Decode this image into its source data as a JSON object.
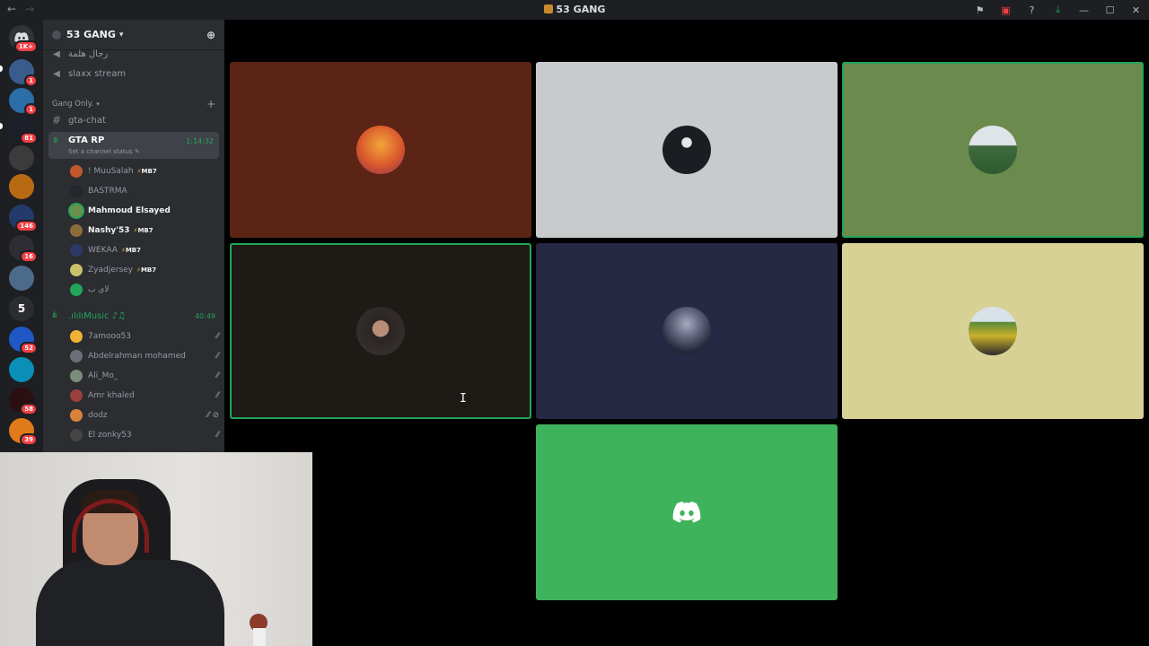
{
  "window": {
    "title": "53 GANG",
    "nav_back": "←",
    "nav_forward": "→"
  },
  "titlebar_icons": [
    "inbox-icon",
    "screen-icon",
    "help-icon",
    "download-icon",
    "minimize-icon",
    "maximize-icon",
    "close-icon"
  ],
  "titlebar_glyphs": {
    "inbox": "⚑",
    "screen": "▣",
    "help": "?",
    "download": "⤓",
    "minimize": "—",
    "maximize": "☐",
    "close": "✕"
  },
  "rail": {
    "home_badge": "1K+",
    "badges": [
      "1",
      "1",
      "81",
      "146",
      "16",
      "52",
      "58",
      "39"
    ],
    "folder_number": "5"
  },
  "sidebar": {
    "guild_name": "53 GANG",
    "channels_top": [
      {
        "name": "رجال هلمة"
      },
      {
        "name": "slaxx stream"
      }
    ],
    "category": "Gang Only.",
    "text_channel": "gta-chat",
    "active_voice": {
      "name": "GTA RP",
      "status": "Set a channel status ✎",
      "time": "1:14:32"
    },
    "voice_users": [
      {
        "name": "! MuuSalah",
        "tag": "MB7",
        "bright": false,
        "color": "#c2572f"
      },
      {
        "name": "BASTRMA",
        "tag": "",
        "bright": false,
        "color": "#23272e"
      },
      {
        "name": "Mahmoud Elsayed",
        "tag": "",
        "bright": true,
        "color": "#6d8f4d"
      },
      {
        "name": "Nashy'53",
        "tag": "MB7",
        "bright": true,
        "color": "#8b6b3a"
      },
      {
        "name": "WEKAA",
        "tag": "MB7",
        "bright": false,
        "color": "#2e3a66"
      },
      {
        "name": "Zyadjersey",
        "tag": "MB7",
        "bright": false,
        "color": "#c9c26b"
      },
      {
        "name": "لاي ب",
        "tag": "",
        "bright": false,
        "color": "#23a55a"
      }
    ],
    "music_channel": {
      "name": ".ılılıMusic ♪♫",
      "time": "40:49"
    },
    "music_users": [
      {
        "name": "7amooo53",
        "color": "#f0b232"
      },
      {
        "name": "Abdelrahman mohamed",
        "color": "#6b6f78"
      },
      {
        "name": "Ali_Mo_",
        "color": "#7a8c7a"
      },
      {
        "name": "Amr khaled",
        "color": "#9c3f3f"
      },
      {
        "name": "dodz",
        "color": "#d9823b"
      },
      {
        "name": "El zonky53",
        "color": "#444"
      }
    ]
  },
  "tiles": [
    {
      "name": "tile-user-1",
      "bg": "#5b2414",
      "speaking": false,
      "avatar": "#d9582c"
    },
    {
      "name": "tile-user-2",
      "bg": "#c8cbcb",
      "speaking": false,
      "avatar": "#1a1d22"
    },
    {
      "name": "tile-user-3",
      "bg": "#6b8a4e",
      "speaking": true,
      "avatar": "#3f6a3f"
    },
    {
      "name": "tile-user-4",
      "bg": "#1e1a16",
      "speaking": true,
      "avatar": "#3a3532"
    },
    {
      "name": "tile-user-5",
      "bg": "#272843",
      "speaking": false,
      "avatar": "#555a72"
    },
    {
      "name": "tile-user-6",
      "bg": "#d8d195",
      "speaking": false,
      "avatar": "#c9b02b"
    },
    {
      "name": "tile-user-7",
      "bg": "#3fb25c",
      "speaking": false,
      "avatar": "discord-logo"
    }
  ],
  "colors": {
    "accent_green": "#23a55a",
    "mention_red": "#f23f43",
    "sidebar": "#2b2d31",
    "rail": "#1e1f22"
  }
}
